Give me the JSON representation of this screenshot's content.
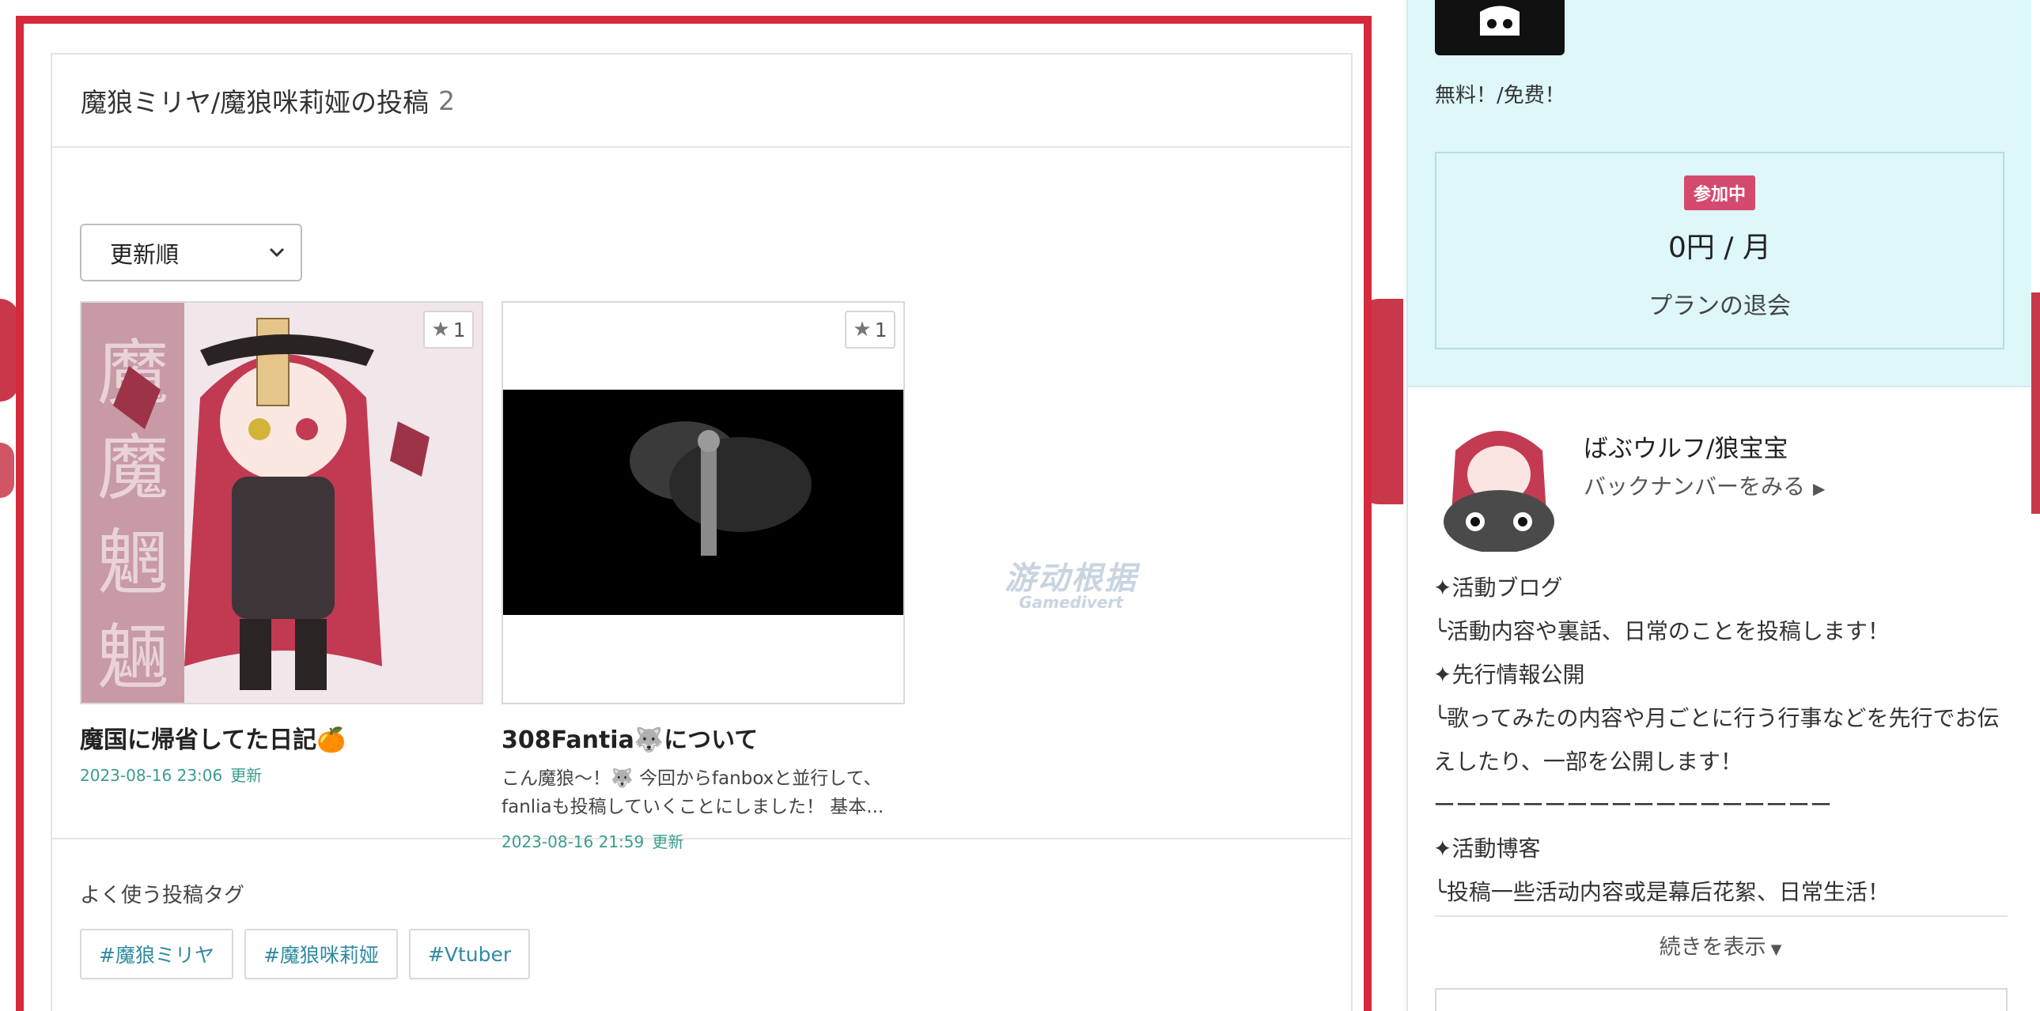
{
  "posts_panel": {
    "title": "魔狼ミリヤ/魔狼咪莉娅の投稿",
    "count": "2",
    "sort": {
      "selected": "更新順"
    },
    "posts": [
      {
        "title": "魔国に帰省してた日記🍊",
        "excerpt": "",
        "date": "2023-08-16 23:06",
        "updated_label": "更新",
        "fav_count": "1"
      },
      {
        "title": "308Fantia🐺について",
        "excerpt": "こん魔狼～！🐺 今回からfanboxと並行して、fanliaも投稿していくことにしました！ 基本...",
        "date": "2023-08-16 21:59",
        "updated_label": "更新",
        "fav_count": "1"
      }
    ],
    "tags_label": "よく使う投稿タグ",
    "tags": [
      "#魔狼ミリヤ",
      "#魔狼咪莉娅",
      "#Vtuber"
    ]
  },
  "watermark": {
    "line1": "游动根据",
    "line2": "Gamedivert"
  },
  "sidebar": {
    "plan": {
      "price_note": "無料！/免费！",
      "badge": "参加中",
      "amount": "0円 / 月",
      "leave_label": "プランの退会"
    },
    "creator": {
      "name": "ばぶウルフ/狼宝宝",
      "backnumber_label": "バックナンバーをみる",
      "description_lines": [
        "✦活動ブログ",
        "╰活動内容や裏話、日常のことを投稿します！",
        "✦先行情報公開",
        "╰歌ってみたの内容や月ごとに行う行事などを先行でお伝えしたり、一部を公開します！",
        "ーーーーーーーーーーーーーーーーーー",
        "✦活動博客",
        "╰投稿一些活动内容或是幕后花絮、日常生活！"
      ],
      "more_label": "続きを表示"
    }
  },
  "colors": {
    "frame_red": "#d62a3c",
    "sidebar_plan_bg": "#def7f9",
    "badge_pink": "#d44a6f",
    "tag_text": "#2f8ba0",
    "meta_green": "#3a9c8f"
  },
  "icons": {
    "favorite": "star-icon",
    "sort_dropdown": "chevron-down-icon",
    "backnumber_arrow": "caret-right-icon",
    "more_toggle": "caret-down-icon"
  }
}
